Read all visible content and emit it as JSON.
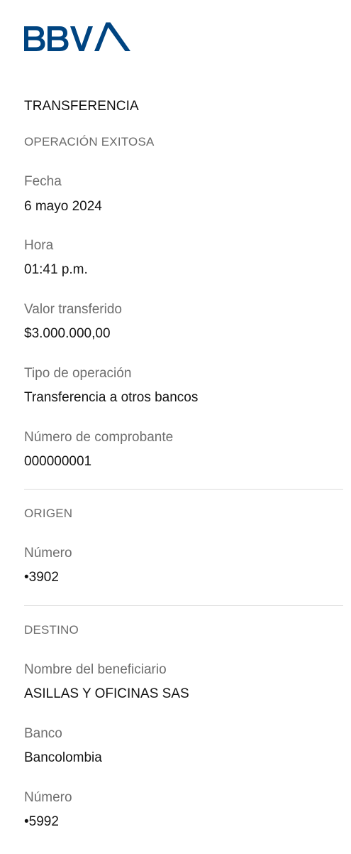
{
  "brand": {
    "name": "BBVA",
    "color": "#004481"
  },
  "header": {
    "title": "TRANSFERENCIA",
    "status": "OPERACIÓN EXITOSA"
  },
  "details": [
    {
      "label": "Fecha",
      "value": "6 mayo 2024"
    },
    {
      "label": "Hora",
      "value": "01:41 p.m."
    },
    {
      "label": "Valor transferido",
      "value": "$3.000.000,00"
    },
    {
      "label": "Tipo de operación",
      "value": "Transferencia a otros bancos"
    },
    {
      "label": "Número de comprobante",
      "value": "000000001"
    }
  ],
  "origin": {
    "heading": "ORIGEN",
    "fields": [
      {
        "label": "Número",
        "value": "•3902"
      }
    ]
  },
  "destination": {
    "heading": "DESTINO",
    "fields": [
      {
        "label": "Nombre del beneficiario",
        "value": "ASILLAS Y OFICINAS SAS"
      },
      {
        "label": "Banco",
        "value": "Bancolombia"
      },
      {
        "label": "Número",
        "value": "•5992"
      }
    ]
  }
}
